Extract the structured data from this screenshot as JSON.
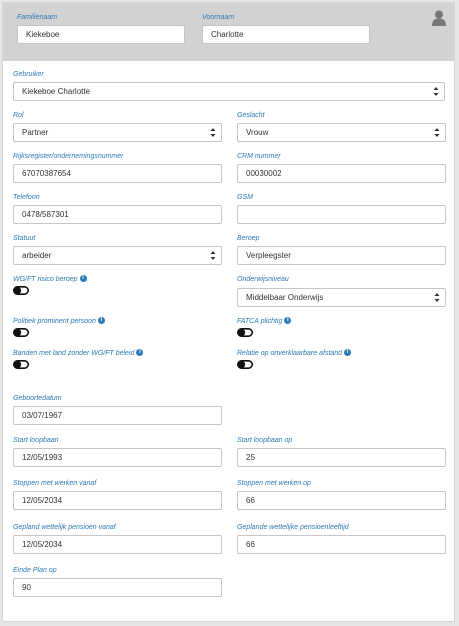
{
  "header": {
    "familienaam_label": "Familienaam",
    "familienaam_value": "Kiekeboe",
    "voornaam_label": "Voornaam",
    "voornaam_value": "Charlotte"
  },
  "form": {
    "gebruiker_label": "Gebruiker",
    "gebruiker_value": "Kiekeboe Charlotte",
    "rol_label": "Rol",
    "rol_value": "Partner",
    "geslacht_label": "Geslacht",
    "geslacht_value": "Vrouw",
    "rijksregister_label": "Rijksregister/ondernemingsnummer",
    "rijksregister_value": "67070387654",
    "crm_label": "CRM nummer",
    "crm_value": "00030002",
    "telefoon_label": "Telefoon",
    "telefoon_value": "0478/587301",
    "gsm_label": "GSM",
    "gsm_value": "",
    "statuut_label": "Statuut",
    "statuut_value": "arbeider",
    "beroep_label": "Beroep",
    "beroep_value": "Verpleegster",
    "wgft_label": "WG/FT risico beroep",
    "onderwijs_label": "Onderwijsniveau",
    "onderwijs_value": "Middelbaar Onderwijs",
    "politiek_label": "Politiek prominent persoon",
    "fatca_label": "FATCA plichtig",
    "banden_label": "Banden met land zonder WG/FT beleid",
    "relatie_label": "Relatie op onverklaarbare afstand",
    "geboortedatum_label": "Geboortedatum",
    "geboortedatum_value": "03/07/1967",
    "start_loopbaan_label": "Start loopbaan",
    "start_loopbaan_value": "12/05/1993",
    "start_loopbaan_op_label": "Start loopbaan op",
    "start_loopbaan_op_value": "25",
    "stoppen_vanaf_label": "Stoppen met werken vanaf",
    "stoppen_vanaf_value": "12/05/2034",
    "stoppen_op_label": "Stoppen met werken op",
    "stoppen_op_value": "66",
    "pensioen_vanaf_label": "Gepland wettelijk pensioen vanaf",
    "pensioen_vanaf_value": "12/05/2034",
    "pensioen_leeftijd_label": "Geplande wettelijke pensioenleeftijd",
    "pensioen_leeftijd_value": "66",
    "einde_plan_label": "Einde Plan op",
    "einde_plan_value": "90"
  },
  "toggles": {
    "wgft": false,
    "politiek": false,
    "fatca": false,
    "banden": false,
    "relatie": false
  },
  "colors": {
    "label": "#2a7ab8",
    "header_bg": "#d2d2d2"
  },
  "icons": {
    "avatar": "user-icon",
    "info": "info-icon",
    "select": "select-arrows-icon"
  }
}
